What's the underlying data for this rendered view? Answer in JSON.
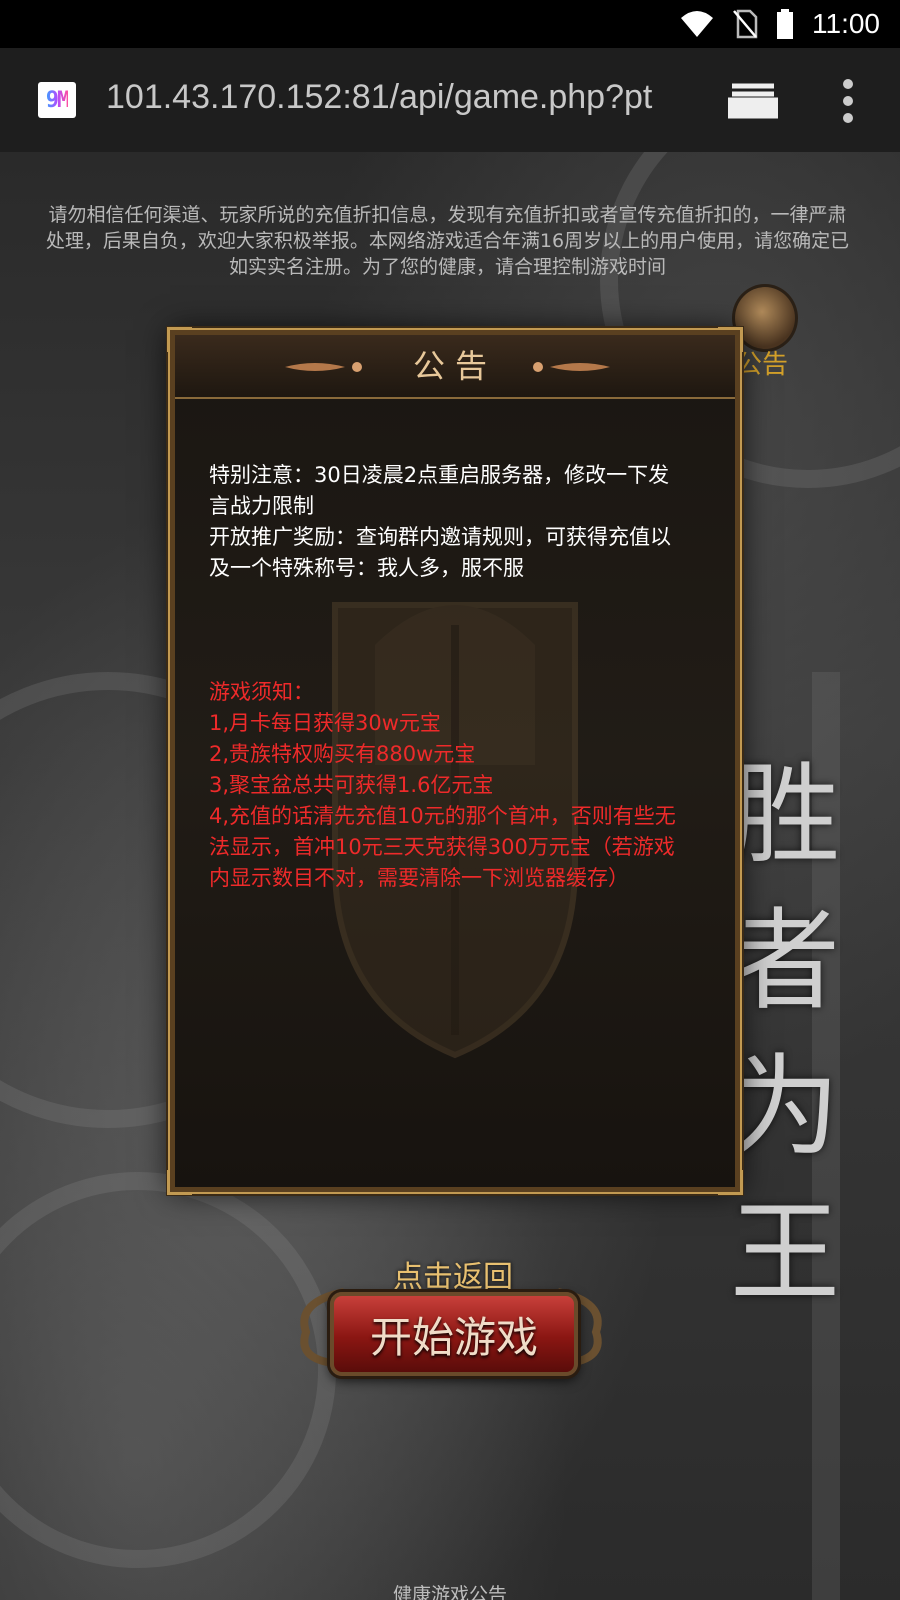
{
  "status_bar": {
    "time": "11:00",
    "wifi_icon": "wifi-icon",
    "signal_icon": "no-sim-icon",
    "battery_icon": "battery-icon"
  },
  "browser": {
    "url": "101.43.170.152:81/api/game.php?pt",
    "site_icon_text": "9M",
    "tabs_icon": "tabs-icon",
    "menu_icon": "more-vert-icon"
  },
  "page": {
    "warning_text": "请勿相信任何渠道、玩家所说的充值折扣信息，发现有充值折扣或者宣传充值折扣的，一律严肃处理，后果自负，欢迎大家积极举报。本网络游戏适合年满16周岁以上的用户使用，请您确定已如实实名注册。为了您的健康，请合理控制游戏时间",
    "side_title": "胜者为王",
    "notice_tab_label": "公告",
    "modal": {
      "title": "公告",
      "white_lines": [
        "特别注意：30日凌晨2点重启服务器，修改一下发言战力限制",
        "开放推广奖励：查询群内邀请规则，可获得充值以及一个特殊称号：我人多，服不服"
      ],
      "red_lines": [
        "游戏须知：",
        "1,月卡每日获得30w元宝",
        "2,贵族特权购买有880w元宝",
        "3,聚宝盆总共可获得1.6亿元宝",
        "4,充值的话清先充值10元的那个首冲，否则有些无法显示，首冲10元三天克获得300万元宝（若游戏内显示数目不对，需要清除一下浏览器缓存）"
      ]
    },
    "return_label": "点击返回",
    "start_label": "开始游戏",
    "health_notice": "健康游戏公告"
  },
  "colors": {
    "accent_gold": "#c29a52",
    "red_text": "#ee2a2a",
    "tab_gold": "#d4a12a"
  }
}
